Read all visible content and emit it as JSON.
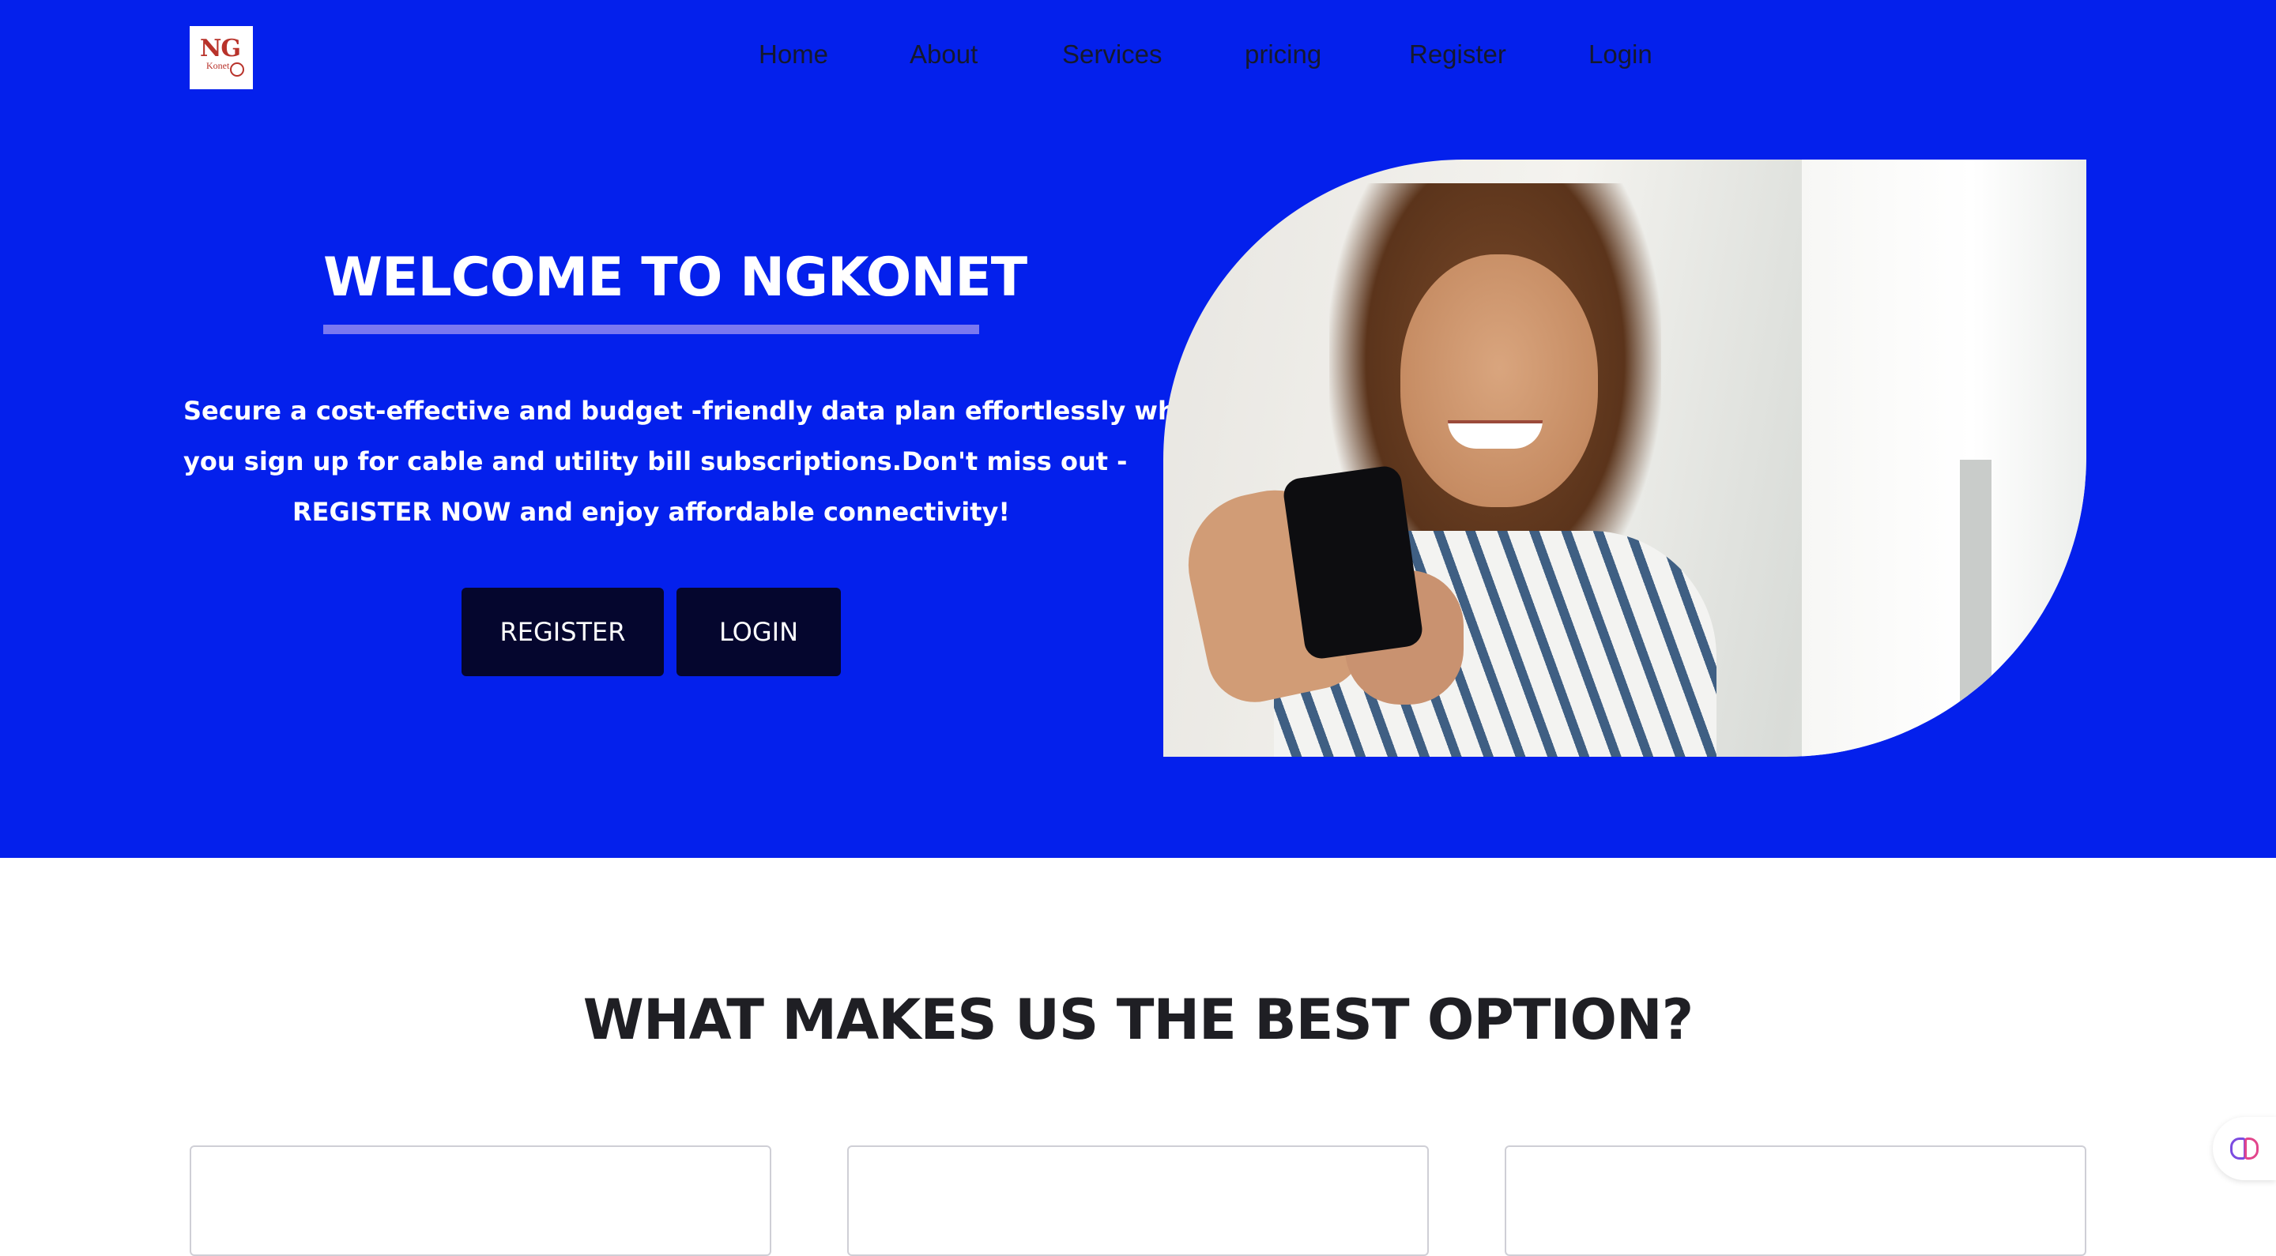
{
  "logo": {
    "text": "NG",
    "subtext": "Konet"
  },
  "nav": {
    "items": [
      "Home",
      "About",
      "Services",
      "pricing",
      "Register",
      "Login"
    ]
  },
  "hero": {
    "title": "WELCOME TO NGKONET",
    "text_lines": [
      "Secure a cost-effective and budget -friendly data plan effortlessly when",
      "you sign up for cable and utility bill subscriptions.Don't miss out -",
      "REGISTER NOW and enjoy affordable connectivity!"
    ],
    "buttons": {
      "register": "REGISTER",
      "login": "LOGIN"
    }
  },
  "section": {
    "title": "WHAT MAKES US THE BEST OPTION?"
  },
  "colors": {
    "hero_background": "#0420ec",
    "button_background": "#05062e",
    "underline": "#7a78f0"
  }
}
